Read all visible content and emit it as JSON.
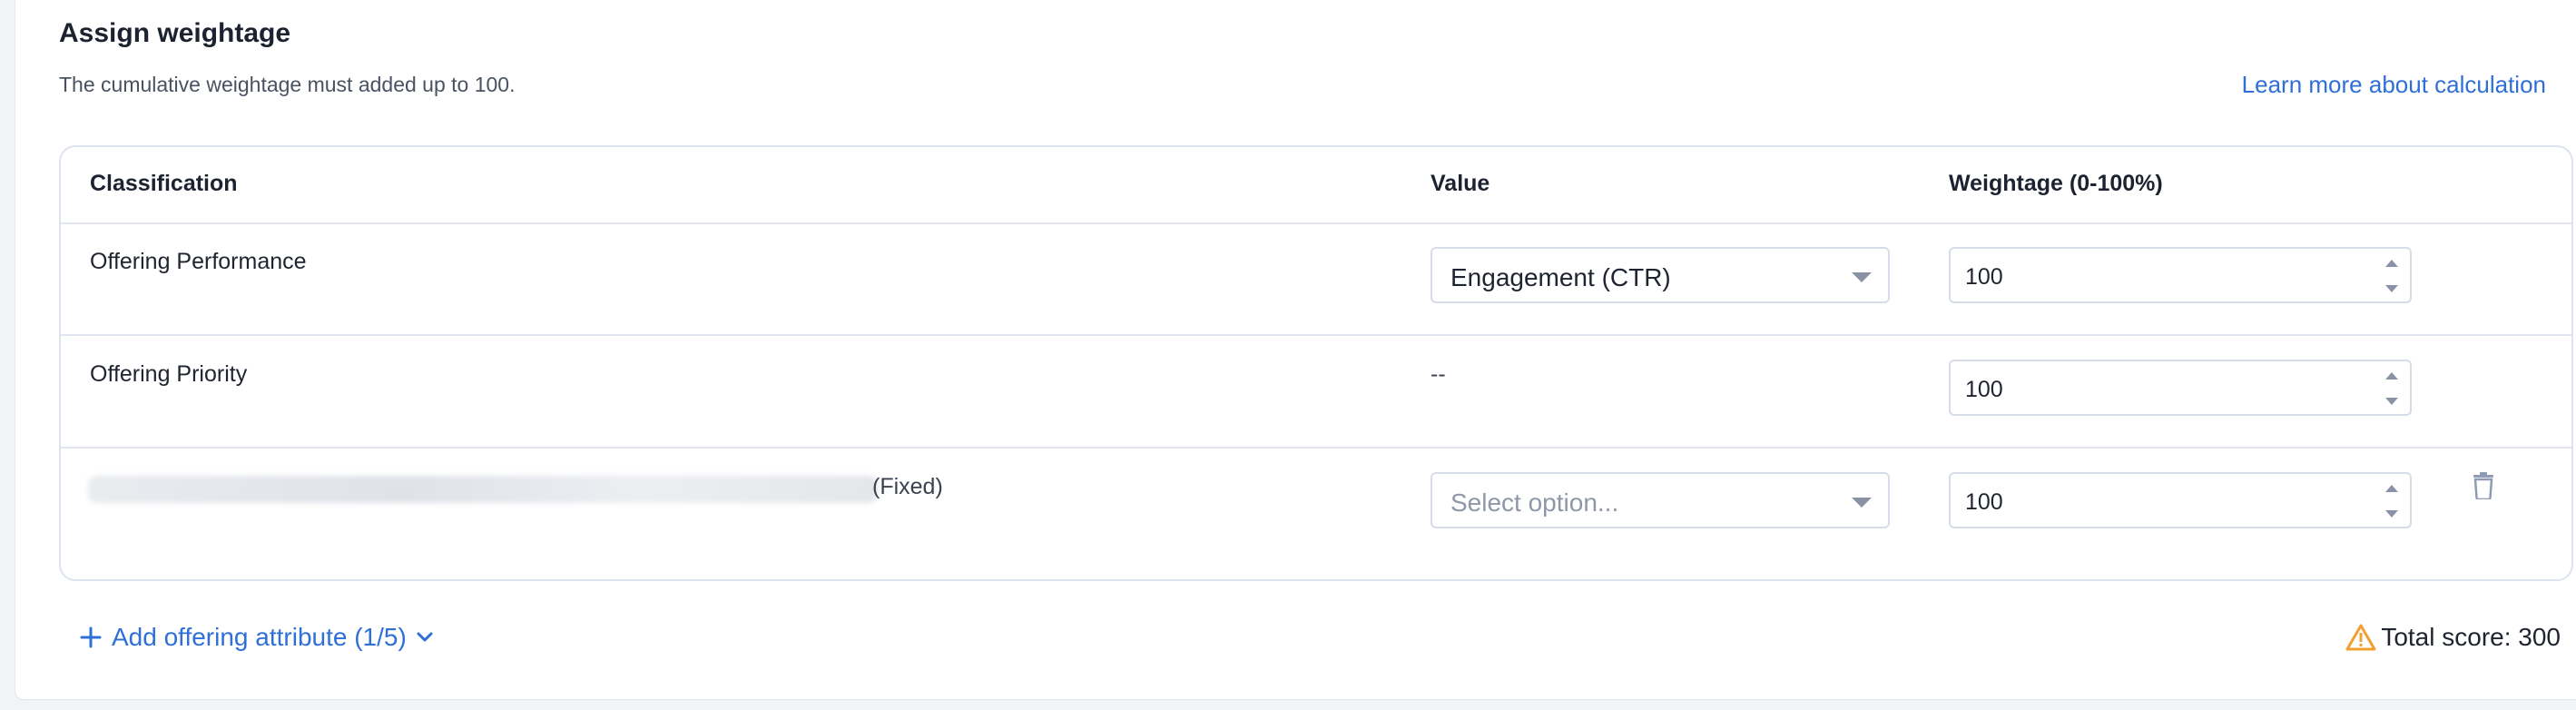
{
  "section": {
    "title": "Assign weightage",
    "subtitle": "The cumulative weightage must added up to 100.",
    "learn_more": "Learn more about calculation"
  },
  "table": {
    "headers": {
      "classification": "Classification",
      "value": "Value",
      "weightage": "Weightage (0-100%)"
    },
    "rows": [
      {
        "classification": "Offering Performance",
        "value": "Engagement (CTR)",
        "weightage": "100"
      },
      {
        "classification": "Offering Priority",
        "value": "--",
        "weightage": "100"
      },
      {
        "classification_suffix": "(Fixed)",
        "value_placeholder": "Select option...",
        "weightage": "100"
      }
    ]
  },
  "footer": {
    "add_attribute": "Add offering attribute (1/5)",
    "total_score": "Total score: 300"
  },
  "colors": {
    "accent": "#2e6fd8",
    "warning": "#f0a030",
    "border": "#dde3ef"
  },
  "icons": [
    "plus-icon",
    "chevron-down-icon",
    "trash-icon",
    "warning-icon",
    "dropdown-caret-icon",
    "spinner-arrows-icon"
  ]
}
